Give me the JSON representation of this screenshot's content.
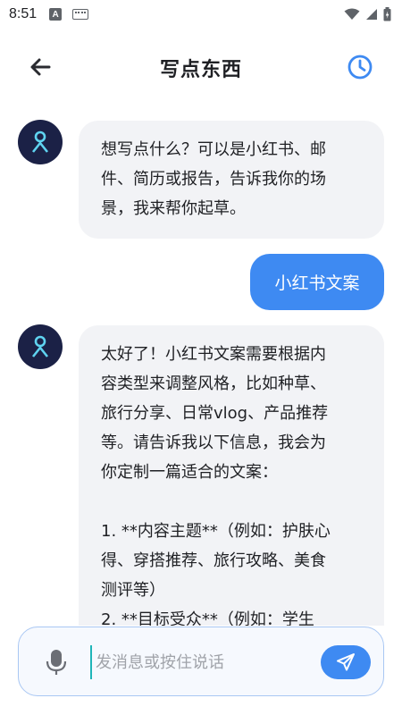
{
  "status_bar": {
    "time": "8:51",
    "icons": [
      "app-a-icon",
      "keyboard-icon",
      "wifi-icon",
      "signal-icon",
      "battery-icon"
    ]
  },
  "header": {
    "title": "写点东西",
    "back_icon": "arrow-left-icon",
    "history_icon": "clock-icon"
  },
  "messages": [
    {
      "role": "assistant",
      "text": "想写点什么？可以是小红书、邮\n件、简历或报告，告诉我你的场\n景，我来帮你起草。"
    },
    {
      "role": "user",
      "text": "小红书文案"
    },
    {
      "role": "assistant",
      "text": "太好了！小红书文案需要根据内\n容类型来调整风格，比如种草、\n旅行分享、日常vlog、产品推荐\n等。请告诉我以下信息，我会为\n你定制一篇适合的文案：\n\n1. **内容主题**（例如：护肤心\n得、穿搭推荐、旅行攻略、美食\n测评等）\n2. **目标受众**（例如：学生"
    }
  ],
  "input": {
    "placeholder": "发消息或按住说话",
    "value": "",
    "mic_icon": "microphone-icon",
    "send_icon": "send-icon"
  },
  "colors": {
    "accent": "#3e8af2",
    "ai_bubble": "#f2f3f6",
    "avatar_bg": "#1b2146",
    "avatar_fg": "#5fd3f0"
  }
}
